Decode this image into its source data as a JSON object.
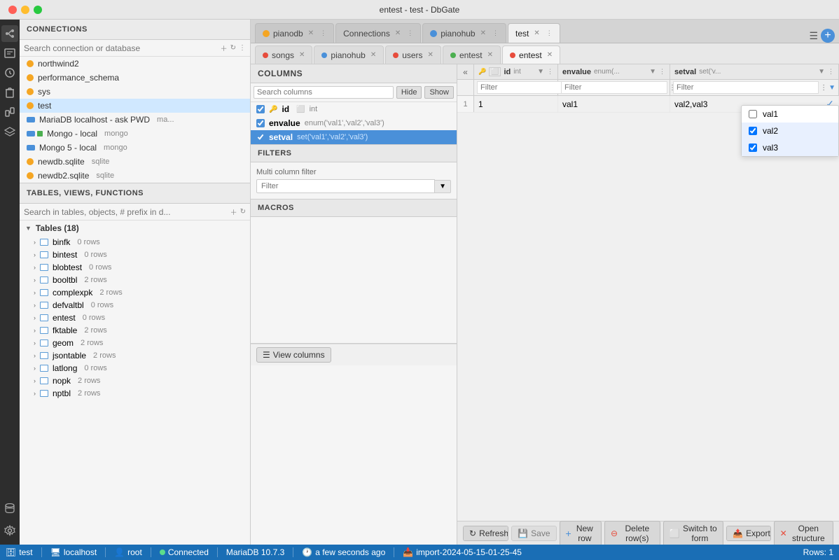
{
  "window": {
    "title": "entest - test - DbGate",
    "close_btn": "●",
    "min_btn": "●",
    "max_btn": "●"
  },
  "tabs": {
    "main_tabs": [
      {
        "id": "pianodb",
        "label": "pianodb",
        "color": "#f5a623",
        "active": false,
        "closable": true
      },
      {
        "id": "connections",
        "label": "Connections",
        "color": "#888",
        "active": false,
        "closable": true
      },
      {
        "id": "pianohub",
        "label": "pianohub",
        "color": "#4a90d9",
        "active": false,
        "closable": true
      },
      {
        "id": "test",
        "label": "test",
        "color": "#888",
        "active": true,
        "closable": true
      }
    ],
    "table_tabs": [
      {
        "id": "songs",
        "label": "songs",
        "color": "#e74c3c",
        "active": false,
        "closable": true
      },
      {
        "id": "pianohub2",
        "label": "pianohub",
        "color": "#4a90d9",
        "active": false,
        "closable": true
      },
      {
        "id": "users",
        "label": "users",
        "color": "#e74c3c",
        "active": false,
        "closable": true
      },
      {
        "id": "entest",
        "label": "entest",
        "color": "#4caf50",
        "active": false,
        "closable": true
      },
      {
        "id": "entest2",
        "label": "entest",
        "color": "#e74c3c",
        "active": true,
        "closable": true
      }
    ]
  },
  "sidebar": {
    "connections_label": "CONNECTIONS",
    "search_placeholder": "Search connection or database",
    "connections": [
      {
        "name": "northwind2",
        "type": "yellow",
        "sub": ""
      },
      {
        "name": "performance_schema",
        "type": "yellow",
        "sub": ""
      },
      {
        "name": "sys",
        "type": "yellow",
        "sub": ""
      },
      {
        "name": "test",
        "type": "yellow",
        "sub": "",
        "active": true
      },
      {
        "name": "MariaDB localhost - ask PWD",
        "type": "blue",
        "sub": "ma..."
      },
      {
        "name": "Mongo - local",
        "type": "blue",
        "sub": "mongo"
      },
      {
        "name": "Mongo 5 - local",
        "type": "blue",
        "sub": "mongo"
      },
      {
        "name": "newdb.sqlite",
        "type": "yellow",
        "sub": "sqlite"
      },
      {
        "name": "newdb2.sqlite",
        "type": "yellow",
        "sub": "sqlite"
      }
    ],
    "tables_label": "TABLES, VIEWS, FUNCTIONS",
    "tables_search_placeholder": "Search in tables, objects, # prefix in d...",
    "tables_group": "Tables (18)",
    "tables": [
      {
        "name": "binfk",
        "rows": "0 rows"
      },
      {
        "name": "bintest",
        "rows": "0 rows"
      },
      {
        "name": "blobtest",
        "rows": "0 rows"
      },
      {
        "name": "booltbl",
        "rows": "2 rows"
      },
      {
        "name": "complexpk",
        "rows": "2 rows"
      },
      {
        "name": "defvaltbl",
        "rows": "0 rows"
      },
      {
        "name": "entest",
        "rows": "0 rows"
      },
      {
        "name": "fktable",
        "rows": "2 rows"
      },
      {
        "name": "geom",
        "rows": "2 rows"
      },
      {
        "name": "jsontable",
        "rows": "2 rows"
      },
      {
        "name": "latlong",
        "rows": "0 rows"
      },
      {
        "name": "nopk",
        "rows": "2 rows"
      },
      {
        "name": "nptbl",
        "rows": "2 rows"
      }
    ]
  },
  "columns_panel": {
    "title": "COLUMNS",
    "search_placeholder": "Search columns",
    "hide_btn": "Hide",
    "show_btn": "Show",
    "columns": [
      {
        "name": "id",
        "type": "int",
        "checked": true,
        "selected": false,
        "icon": "🔑"
      },
      {
        "name": "envalue",
        "type": "enum('val1','val2','val3')",
        "checked": true,
        "selected": false
      },
      {
        "name": "setval",
        "type": "set('val1','val2','val3')",
        "checked": true,
        "selected": true
      }
    ]
  },
  "filters_panel": {
    "title": "FILTERS",
    "multi_column_label": "Multi column filter",
    "filter_placeholder": "Filter"
  },
  "macros_panel": {
    "title": "MACROS"
  },
  "grid": {
    "collapse_icon": "«",
    "columns": [
      {
        "name": "id",
        "type": "int",
        "icon": "🔑"
      },
      {
        "name": "envalue",
        "type": "enum(...)"
      },
      {
        "name": "setval",
        "type": "set('v..."
      }
    ],
    "rows": [
      {
        "num": "1",
        "id": "1",
        "envalue": "val1",
        "setval": "val2,val3"
      }
    ]
  },
  "dropdown": {
    "items": [
      {
        "label": "val1",
        "checked": false
      },
      {
        "label": "val2",
        "checked": true
      },
      {
        "label": "val3",
        "checked": true
      }
    ]
  },
  "toolbar": {
    "refresh_label": "Refresh",
    "save_label": "Save",
    "new_row_label": "New row",
    "delete_row_label": "Delete row(s)",
    "switch_form_label": "Switch to form",
    "export_label": "Export",
    "open_structure_label": "Open structure",
    "view_columns_label": "View columns"
  },
  "status_bar": {
    "db_name": "test",
    "host": "localhost",
    "user": "root",
    "status": "Connected",
    "db_version": "MariaDB 10.7.3",
    "timestamp": "a few seconds ago",
    "import_info": "import-2024-05-15-01-25-45",
    "rows": "Rows: 1"
  }
}
